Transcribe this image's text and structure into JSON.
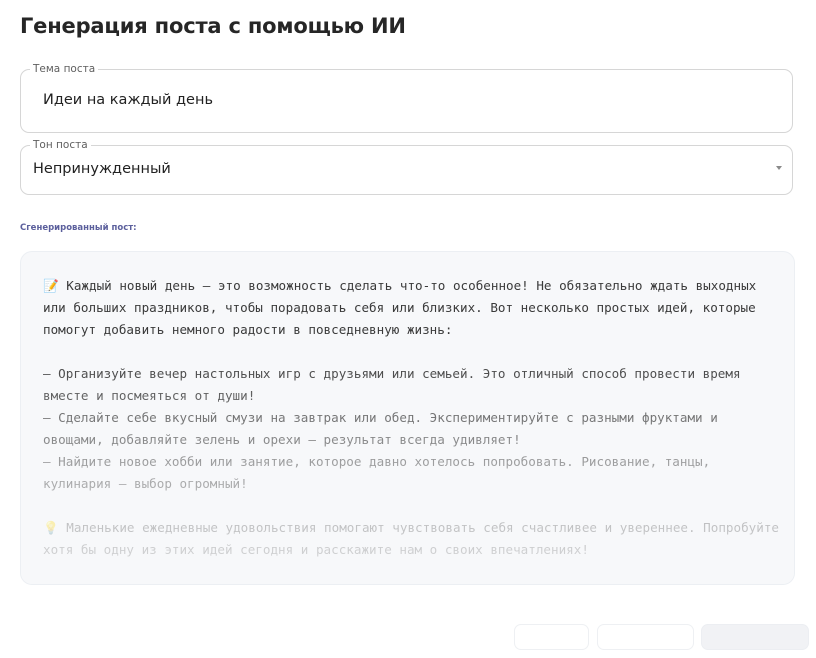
{
  "page": {
    "title": "Генерация поста с помощью ИИ"
  },
  "topic_field": {
    "label": "Тема поста",
    "value": "Идеи на каждый день"
  },
  "tone_field": {
    "label": "Тон поста",
    "value": "Непринужденный"
  },
  "generated": {
    "label": "Сгенерированный пост:",
    "paragraphs": [
      "📝 Каждый новый день — это возможность сделать что-то особенное! Не обязательно ждать выходных или больших праздников, чтобы порадовать себя или близких. Вот несколько простых идей, которые помогут добавить немного радости в повседневную жизнь:",
      "",
      "– Организуйте вечер настольных игр с друзьями или семьей. Это отличный способ провести время вместе и посмеяться от души!",
      "– Сделайте себе вкусный смузи на завтрак или обед. Экспериментируйте с разными фруктами и овощами, добавляйте зелень и орехи — результат всегда удивляет!",
      "– Найдите новое хобби или занятие, которое давно хотелось попробовать. Рисование, танцы, кулинария — выбор огромный!",
      "",
      "💡 Маленькие ежедневные удовольствия помогают чувствовать себя счастливее и увереннее. Попробуйте хотя бы одну из этих идей сегодня и расскажите нам о своих впечатлениях!"
    ]
  },
  "actions": {
    "button_1": "",
    "button_2": "",
    "button_3": ""
  },
  "colors": {
    "accent_label": "#5b5f9c",
    "border": "#d6d6d6",
    "output_bg": "#f7f8fa"
  }
}
